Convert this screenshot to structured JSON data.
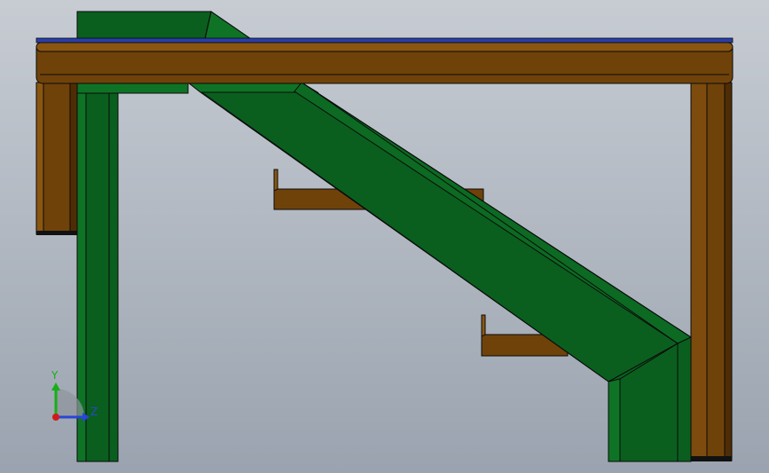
{
  "viewport": {
    "background_top": "#c7ccd3",
    "background_bottom": "#9aa3af"
  },
  "colors": {
    "green_face": "#0a5f1e",
    "green_dark": "#064716",
    "green_light": "#0f7326",
    "brown_face": "#6f420a",
    "brown_dark": "#4f2d04",
    "brown_light": "#8a560f",
    "blue_plate": "#2a3ea8",
    "edge": "#0b0b0b"
  },
  "triad": {
    "y_label": "Y",
    "z_label": "Z",
    "y_color": "#14b014",
    "z_color": "#2a44d8",
    "x_color": "#d21a1a",
    "icon": "coordinate-triad-icon"
  }
}
